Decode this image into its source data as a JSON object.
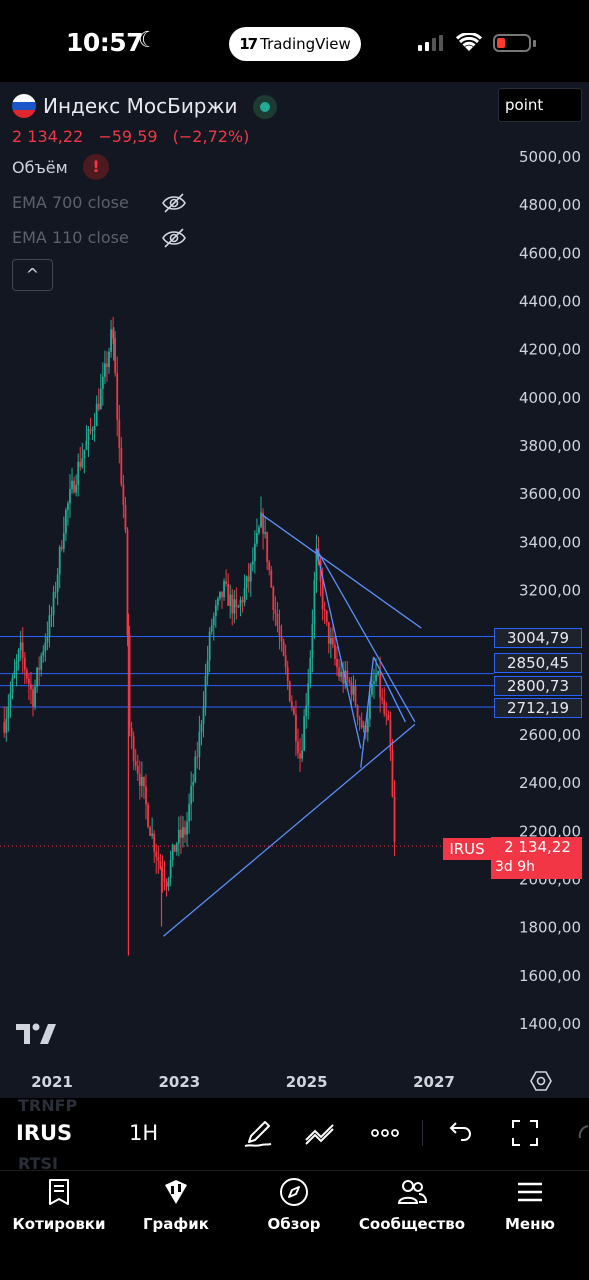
{
  "status_bar": {
    "time": "10:57",
    "app_pill": "TradingView"
  },
  "legend": {
    "symbol_name": "Индекс МосБиржи",
    "last": "2 134,22",
    "change": "−59,59",
    "change_pct": "(−2,72%)",
    "volume_label": "Объём",
    "volume_warning": "!",
    "ema1": "EMA 700 close",
    "ema2": "EMA 110 close",
    "collapse": "^"
  },
  "point_button": "point",
  "price_axis_labels": [
    "5000,00",
    "4800,00",
    "4600,00",
    "4400,00",
    "4200,00",
    "4000,00",
    "3800,00",
    "3600,00",
    "3400,00",
    "3200,00",
    "2600,00",
    "2400,00",
    "2200,00",
    "2000,00",
    "1800,00",
    "1600,00",
    "1400,00"
  ],
  "horizontal_levels": [
    {
      "label": "3004,79",
      "value": 3004.79
    },
    {
      "label": "2850,45",
      "value": 2850.45
    },
    {
      "label": "2800,73",
      "value": 2800.73
    },
    {
      "label": "2712,19",
      "value": 2712.19
    }
  ],
  "last_price": {
    "symbol_tag": "IRUS",
    "price": "2 134,22",
    "countdown": "3d 9h"
  },
  "time_axis_labels": [
    "2021",
    "2023",
    "2025",
    "2027"
  ],
  "toolbar": {
    "ghost_top": "TRNFP",
    "ghost_bottom": "RTSI",
    "ticker": "IRUS",
    "interval": "1H"
  },
  "tabs": [
    {
      "label": "Котировки",
      "icon": "quotes-icon"
    },
    {
      "label": "График",
      "icon": "chart-icon"
    },
    {
      "label": "Обзор",
      "icon": "compass-icon"
    },
    {
      "label": "Сообщество",
      "icon": "community-icon"
    },
    {
      "label": "Меню",
      "icon": "menu-icon"
    }
  ],
  "colors": {
    "background": "#131722",
    "up": "#22ab94",
    "down": "#f23645",
    "drawing": "#5b8ff9",
    "level": "#2962ff"
  },
  "chart_data": {
    "type": "candlestick",
    "symbol": "IRUS",
    "title": "Индекс МосБиржи",
    "interval": "1H",
    "y_axis_range": [
      1300,
      5100
    ],
    "x_axis_range": [
      2020.25,
      2027.4
    ],
    "x_ticks": [
      "2021",
      "2023",
      "2025",
      "2027"
    ],
    "approximate_close_path": [
      [
        2020.25,
        2650
      ],
      [
        2020.5,
        2950
      ],
      [
        2020.7,
        2750
      ],
      [
        2020.85,
        2950
      ],
      [
        2021.0,
        3100
      ],
      [
        2021.2,
        3500
      ],
      [
        2021.4,
        3700
      ],
      [
        2021.6,
        3850
      ],
      [
        2021.8,
        4050
      ],
      [
        2021.95,
        4280
      ],
      [
        2022.05,
        3800
      ],
      [
        2022.15,
        3450
      ],
      [
        2022.22,
        2600
      ],
      [
        2022.4,
        2400
      ],
      [
        2022.55,
        2200
      ],
      [
        2022.7,
        2050
      ],
      [
        2022.8,
        2000
      ],
      [
        2022.95,
        2150
      ],
      [
        2023.1,
        2200
      ],
      [
        2023.3,
        2550
      ],
      [
        2023.5,
        3050
      ],
      [
        2023.7,
        3200
      ],
      [
        2023.9,
        3100
      ],
      [
        2024.1,
        3250
      ],
      [
        2024.3,
        3500
      ],
      [
        2024.45,
        3200
      ],
      [
        2024.6,
        2950
      ],
      [
        2024.75,
        2750
      ],
      [
        2024.9,
        2500
      ],
      [
        2025.05,
        2900
      ],
      [
        2025.15,
        3350
      ],
      [
        2025.3,
        3050
      ],
      [
        2025.5,
        2850
      ],
      [
        2025.7,
        2800
      ],
      [
        2025.9,
        2600
      ],
      [
        2026.0,
        2750
      ],
      [
        2026.1,
        2850
      ],
      [
        2026.2,
        2700
      ],
      [
        2026.3,
        2600
      ],
      [
        2026.38,
        2134.22
      ]
    ],
    "range_low": 1680,
    "range_high": 4290,
    "last": 2134.22,
    "change": -59.59,
    "change_pct": -2.72,
    "horizontal_lines": [
      3004.79,
      2850.45,
      2800.73,
      2712.19
    ],
    "trendlines": [
      {
        "from": [
          2024.3,
          3510
        ],
        "to": [
          2026.8,
          3040
        ]
      },
      {
        "from": [
          2025.15,
          3370
        ],
        "to": [
          2026.7,
          2650
        ]
      },
      {
        "from": [
          2022.75,
          1760
        ],
        "to": [
          2026.7,
          2640
        ]
      },
      {
        "from": [
          2025.15,
          3370
        ],
        "to": [
          2025.85,
          2540
        ]
      },
      {
        "from": [
          2025.85,
          2460
        ],
        "to": [
          2026.05,
          2920
        ]
      },
      {
        "from": [
          2026.05,
          2920
        ],
        "to": [
          2026.55,
          2650
        ]
      }
    ]
  }
}
